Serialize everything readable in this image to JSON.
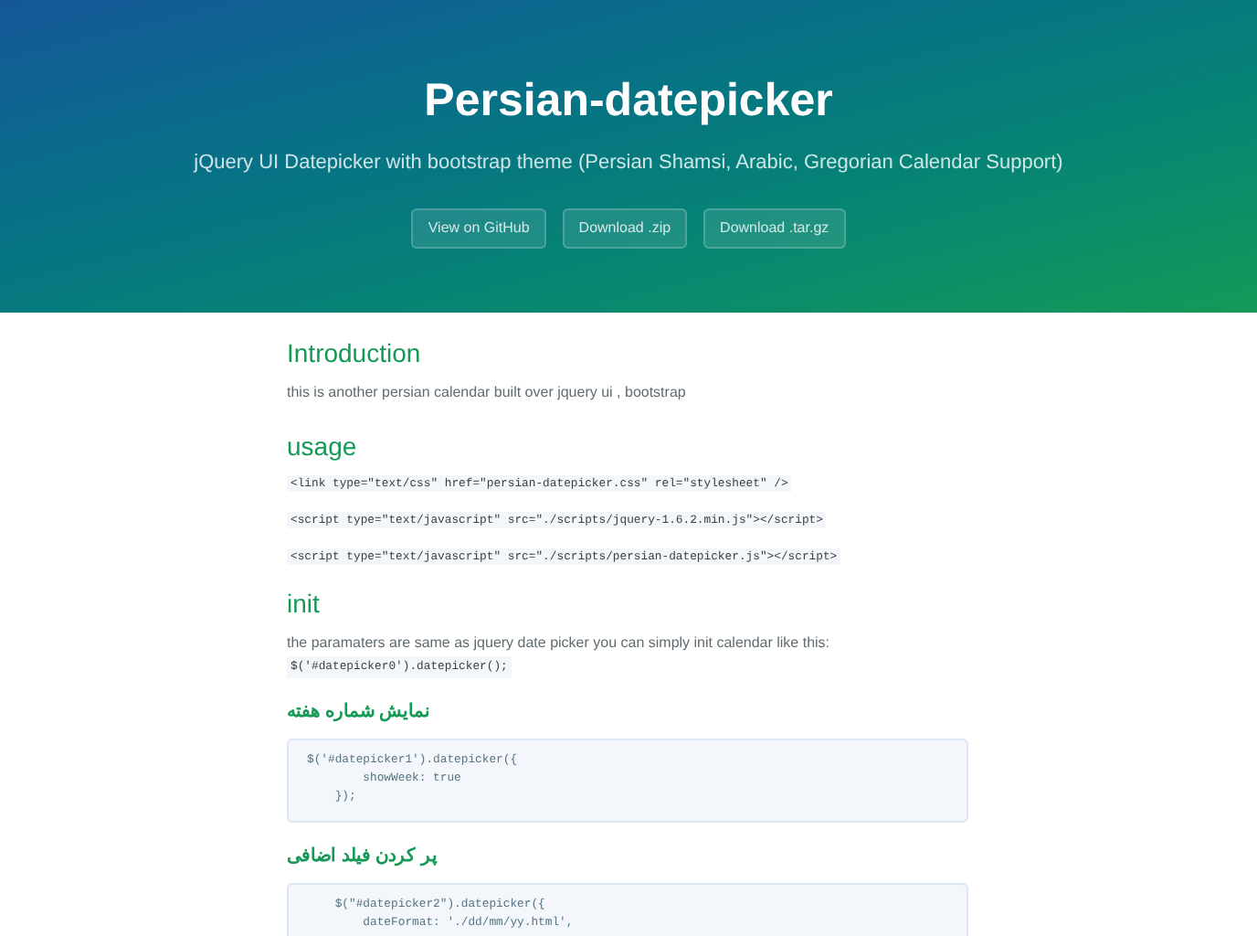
{
  "header": {
    "title": "Persian-datepicker",
    "tagline": "jQuery UI Datepicker with bootstrap theme (Persian Shamsi, Arabic, Gregorian Calendar Support)",
    "buttons": [
      "View on GitHub",
      "Download .zip",
      "Download .tar.gz"
    ]
  },
  "content": [
    {
      "kind": "heading",
      "text": "Introduction"
    },
    {
      "kind": "paragraph",
      "text": "this is another persian calendar built over jquery ui , bootstrap"
    },
    {
      "kind": "heading",
      "text": "usage"
    },
    {
      "kind": "code_inline",
      "text": "<link type=\"text/css\" href=\"persian-datepicker.css\" rel=\"stylesheet\" />"
    },
    {
      "kind": "code_inline",
      "text": "<script type=\"text/javascript\" src=\"./scripts/jquery-1.6.2.min.js\"></script>"
    },
    {
      "kind": "code_inline",
      "text": "<script type=\"text/javascript\" src=\"./scripts/persian-datepicker.js\"></script>"
    },
    {
      "kind": "heading",
      "text": "init"
    },
    {
      "kind": "paragraph_code",
      "text": "the paramaters are same as jquery date picker you can simply init calendar like this:",
      "code": "$('#datepicker0').datepicker();"
    },
    {
      "kind": "subheading",
      "text": "نمایش شماره هفته"
    },
    {
      "kind": "code_block",
      "lines": [
        "$('#datepicker1').datepicker({",
        "        showWeek: true",
        "    });"
      ]
    },
    {
      "kind": "subheading",
      "text": "پر کردن فیلد اضافی"
    },
    {
      "kind": "code_block",
      "lines": [
        "    $(\"#datepicker2\").datepicker({",
        "        dateFormat: './dd/mm/yy.html',"
      ]
    }
  ]
}
